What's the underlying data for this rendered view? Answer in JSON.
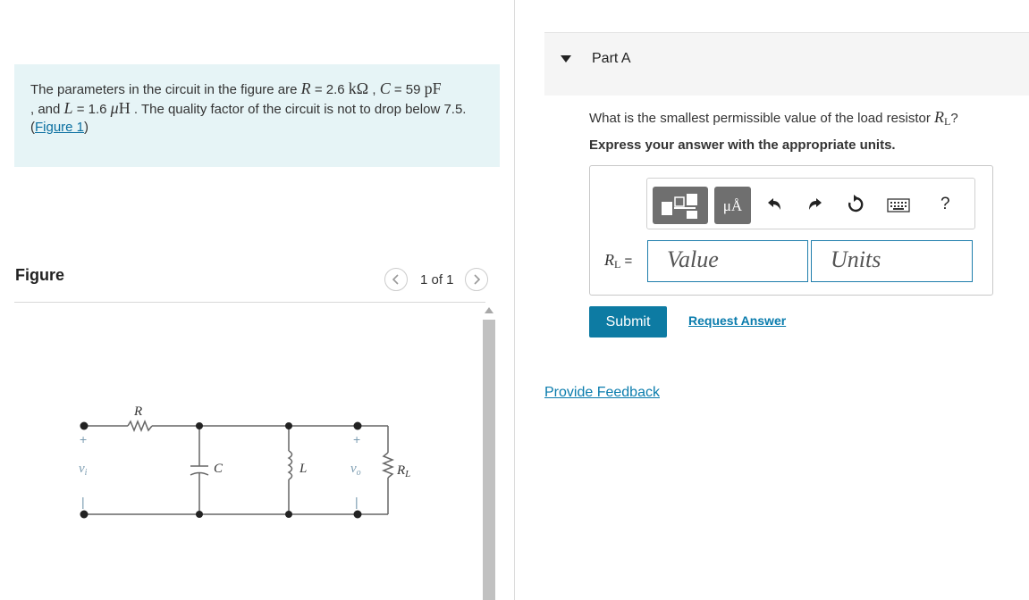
{
  "problem": {
    "text_1": "The parameters in the circuit in the figure are ",
    "r_sym": "R",
    "r_val": " = 2.6 ",
    "r_unit": "kΩ",
    "sep_c": " , ",
    "c_sym": "C",
    "c_val": " = 59 ",
    "c_unit": "pF",
    "text_2": ", and ",
    "l_sym": "L",
    "l_val": " = 1.6 ",
    "l_mu": "μ",
    "l_unit": "H",
    "text_3": " . The quality factor of the circuit is not to drop below 7.5.",
    "figure_link_open": "(",
    "figure_link": "Figure 1",
    "figure_link_close": ")"
  },
  "figure": {
    "title": "Figure",
    "pager_text": "1 of 1",
    "prev_icon": "chevron-left",
    "next_icon": "chevron-right",
    "labels": {
      "R": "R",
      "C": "C",
      "L": "L",
      "vi": "v",
      "vi_sub": "i",
      "vo": "v",
      "vo_sub": "o",
      "RL": "R",
      "RL_sub": "L",
      "plus": "+",
      "minus": "|"
    }
  },
  "part": {
    "label": "Part A",
    "question_prefix": "What is the smallest permissible value of the load resistor ",
    "question_sym": "R",
    "question_sub": "L",
    "question_suffix": "?",
    "instruction": "Express your answer with the appropriate units."
  },
  "answer": {
    "rl_sym": "R",
    "rl_sub": "L",
    "rl_eq": " =",
    "value_placeholder": "Value",
    "units_placeholder": "Units",
    "units_button_text": "μÅ",
    "toolbar_icons": [
      "templates-icon",
      "units-icon",
      "undo-icon",
      "redo-icon",
      "reset-icon",
      "keyboard-icon",
      "help-icon"
    ],
    "help_text": "?"
  },
  "buttons": {
    "submit": "Submit",
    "request_answer": "Request Answer",
    "provide_feedback": "Provide Feedback"
  },
  "colors": {
    "accent": "#0d7ba3",
    "link": "#0a7cad",
    "problem_bg": "#e6f4f6",
    "field_border": "#1f7eac"
  }
}
